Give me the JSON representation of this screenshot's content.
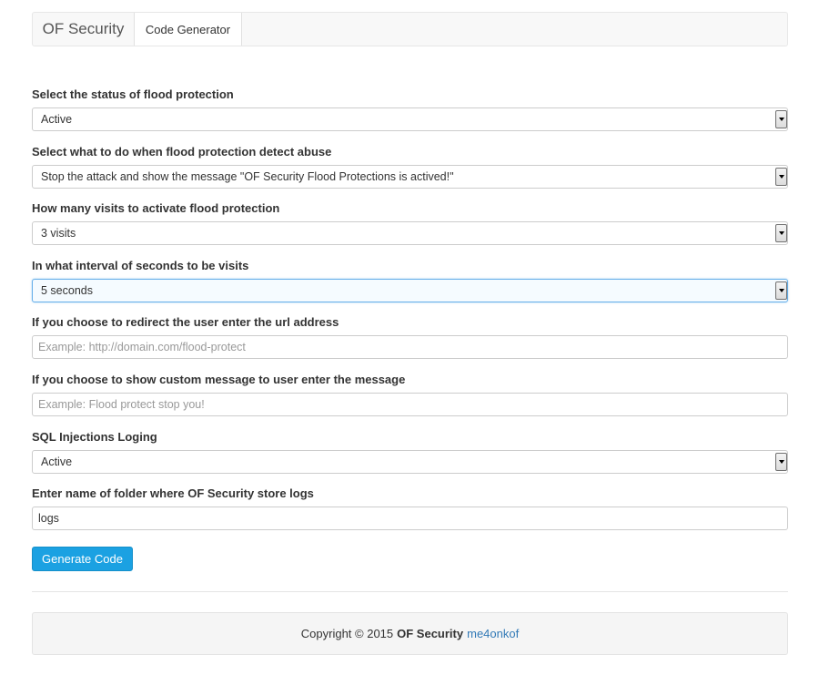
{
  "nav": {
    "brand": "OF Security",
    "tab": "Code Generator"
  },
  "form": {
    "flood_status": {
      "label": "Select the status of flood protection",
      "value": "Active"
    },
    "flood_action": {
      "label": "Select what to do when flood protection detect abuse",
      "value": "Stop the attack and show the message \"OF Security Flood Protections is actived!\""
    },
    "visits": {
      "label": "How many visits to activate flood protection",
      "value": "3 visits"
    },
    "interval": {
      "label": "In what interval of seconds to be visits",
      "value": "5 seconds"
    },
    "redirect_url": {
      "label": "If you choose to redirect the user enter the url address",
      "value": "",
      "placeholder": "Example: http://domain.com/flood-protect"
    },
    "custom_message": {
      "label": "If you choose to show custom message to user enter the message",
      "value": "",
      "placeholder": "Example: Flood protect stop you!"
    },
    "sql_logging": {
      "label": "SQL Injections Loging",
      "value": "Active"
    },
    "log_folder": {
      "label": "Enter name of folder where OF Security store logs",
      "value": "logs"
    }
  },
  "button": {
    "generate": "Generate Code"
  },
  "footer": {
    "copyright": "Copyright © 2015",
    "brand": "OF Security",
    "author": "me4onkof"
  },
  "colors": {
    "button_bg": "#1ba1e2",
    "link": "#337ab7",
    "focus_border": "#66afe9"
  },
  "icons": {
    "select_arrow": "chevron-down-icon"
  }
}
